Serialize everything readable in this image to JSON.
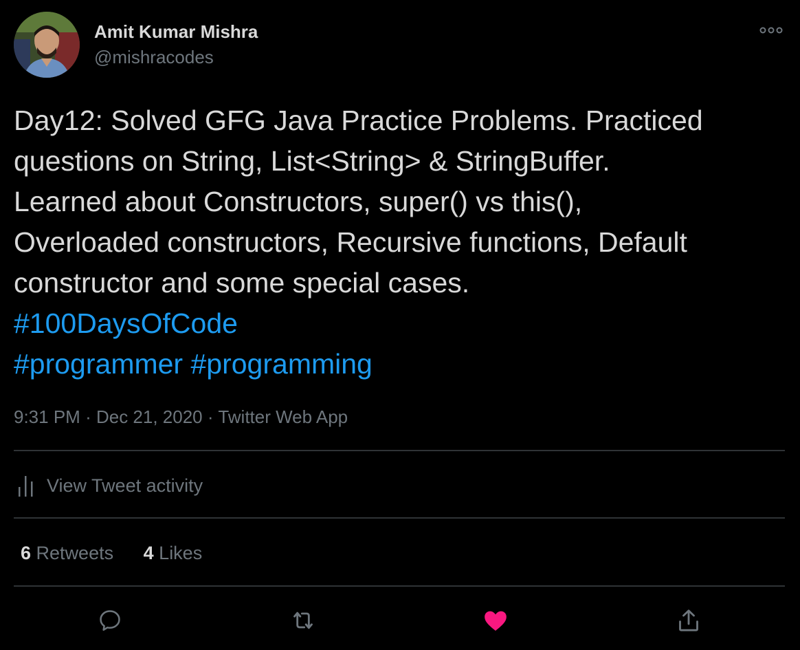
{
  "author": {
    "display_name": "Amit Kumar Mishra",
    "handle": "@mishracodes"
  },
  "tweet": {
    "lines": [
      "Day12: Solved GFG Java Practice Problems. Practiced",
      "questions on String, List<String> & StringBuffer.",
      "Learned about Constructors, super() vs this(),",
      "Overloaded constructors, Recursive functions, Default",
      "constructor and some special cases."
    ],
    "hashtags": [
      "#100DaysOfCode",
      "#programmer",
      "#programming"
    ]
  },
  "meta": {
    "time": "9:31 PM",
    "separator": "·",
    "date": "Dec 21, 2020",
    "source": "Twitter Web App"
  },
  "activity": {
    "label": "View Tweet activity",
    "icon": "bar-chart-icon"
  },
  "stats": {
    "retweets_count": "6",
    "retweets_label": "Retweets",
    "likes_count": "4",
    "likes_label": "Likes"
  },
  "actions": {
    "reply_icon": "reply-icon",
    "retweet_icon": "retweet-icon",
    "like_icon": "heart-icon",
    "share_icon": "share-icon"
  },
  "colors": {
    "background": "#000000",
    "text": "#d9d9d9",
    "secondary": "#6e767d",
    "link": "#1d9bf0",
    "like": "#f91880",
    "divider": "#2f3336"
  }
}
